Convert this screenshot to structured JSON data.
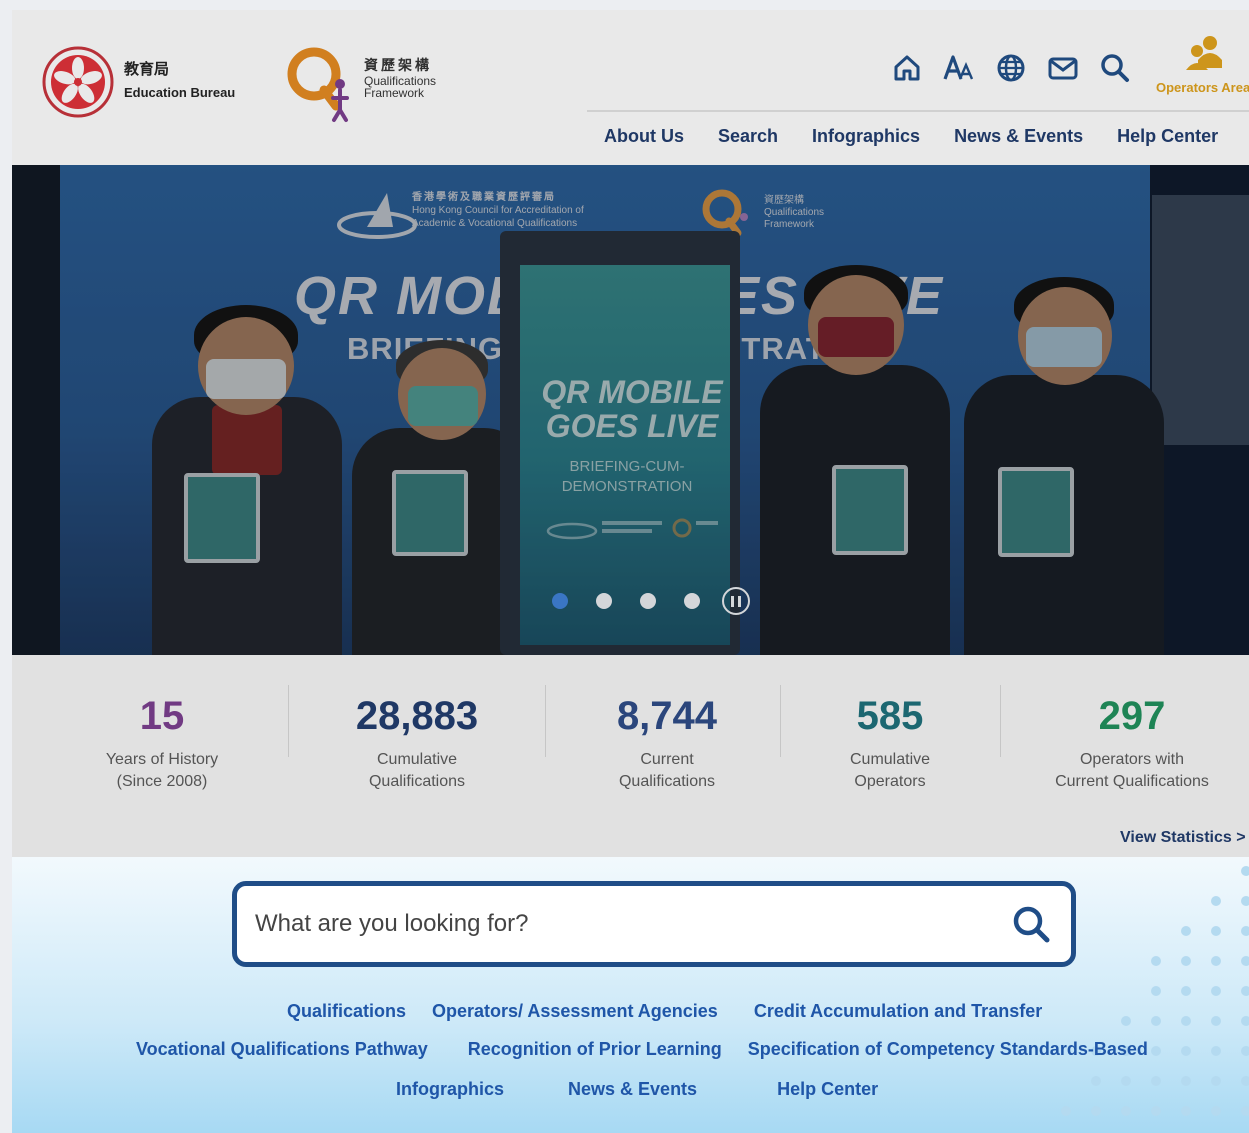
{
  "header": {
    "edb_name_cn": "教育局",
    "edb_name_en": "Education Bureau",
    "qf_name_cn": "資歷架構",
    "qf_name_en_1": "Qualifications",
    "qf_name_en_2": "Framework",
    "utility_icons": [
      "home-icon",
      "font-size-icon",
      "globe-icon",
      "mail-icon",
      "search-icon"
    ],
    "operators_label": "Operators Area",
    "accent_color": "#e0a21a",
    "nav": [
      "About Us",
      "Search",
      "Infographics",
      "News & Events",
      "Help Center"
    ]
  },
  "hero": {
    "banner_title": "QR MOBILE GOES LIVE",
    "banner_subtitle": "BRIEFING-CUM-DEMONSTRATION",
    "hkaa_name_cn": "香港學術及職業資歷評審局",
    "hkaa_name_en_1": "Hong Kong Council for Accreditation of",
    "hkaa_name_en_2": "Academic & Vocational Qualifications",
    "qf_name_cn": "資歷架構",
    "qf_name_en_1": "Qualifications",
    "qf_name_en_2": "Framework",
    "kiosk_title_1": "QR MOBILE",
    "kiosk_title_2": "GOES LIVE",
    "kiosk_sub_1": "BRIEFING-CUM-",
    "kiosk_sub_2": "DEMONSTRATION",
    "slide_count": 4,
    "active_slide": 1
  },
  "stats": [
    {
      "value": "15",
      "label_1": "Years of History",
      "label_2": "(Since 2008)",
      "color": "#7a3d8e"
    },
    {
      "value": "28,883",
      "label_1": "Cumulative",
      "label_2": "Qualifications",
      "color": "#1f3a6d"
    },
    {
      "value": "8,744",
      "label_1": "Current",
      "label_2": "Qualifications",
      "color": "#2c4a86"
    },
    {
      "value": "585",
      "label_1": "Cumulative",
      "label_2": "Operators",
      "color": "#1b6f7a"
    },
    {
      "value": "297",
      "label_1": "Operators with",
      "label_2": "Current Qualifications",
      "color": "#1e8f5b"
    }
  ],
  "view_statistics": "View Statistics >",
  "search": {
    "placeholder": "What are you looking for?",
    "quick_links_row1": [
      "Qualifications",
      "Operators/ Assessment Agencies",
      "Credit Accumulation and Transfer"
    ],
    "quick_links_row2": [
      "Vocational Qualifications Pathway",
      "Recognition of Prior Learning",
      "Specification of Competency Standards-Based"
    ],
    "quick_links_row3": [
      "Infographics",
      "News & Events",
      "Help Center"
    ]
  }
}
